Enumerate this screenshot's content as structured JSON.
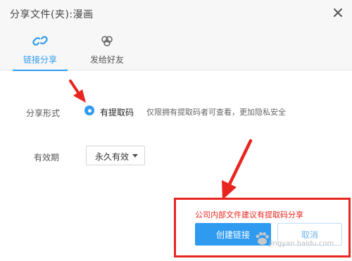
{
  "dialog": {
    "title": "分享文件(夹):漫画"
  },
  "tabs": [
    {
      "label": "链接分享",
      "active": true,
      "icon": "link-icon"
    },
    {
      "label": "发给好友",
      "active": false,
      "icon": "friends-icon"
    }
  ],
  "form": {
    "share_form_label": "分享形式",
    "option_selected": "有提取码",
    "option_hint": "仅限拥有提取码者可查看，更加隐私安全",
    "validity_label": "有效期",
    "validity_value": "永久有效"
  },
  "annotation": {
    "note": "公司内部文件建议有提取码分享",
    "color": "#e8251f"
  },
  "buttons": {
    "create_label": "创建链接",
    "cancel_label": "取消"
  },
  "watermark": {
    "text": "jingyan.baidu.com"
  },
  "colors": {
    "accent": "#2e9bf0",
    "annotation_red": "#e8251f"
  }
}
